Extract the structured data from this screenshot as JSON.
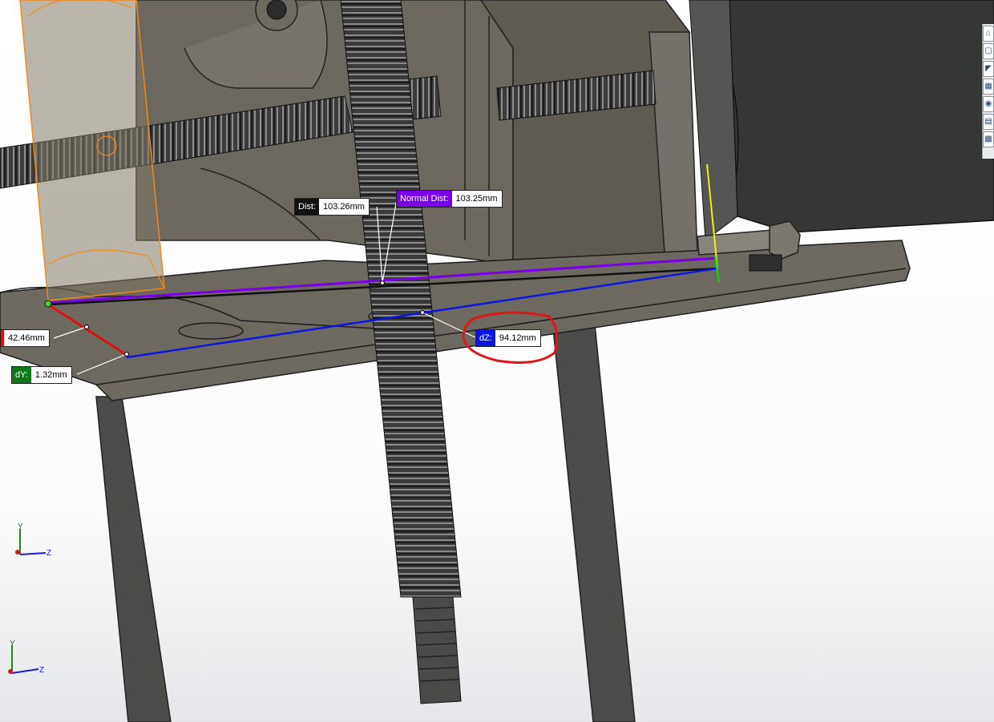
{
  "measurements": {
    "dist": {
      "label": "Dist:",
      "value": "103.26mm"
    },
    "normal_dist": {
      "label": "Normal Dist:",
      "value": "103.25mm"
    },
    "dz": {
      "label": "dZ:",
      "value": "94.12mm"
    },
    "dx": {
      "value": "42.46mm"
    },
    "dy": {
      "label": "dY:",
      "value": "1.32mm"
    }
  },
  "triad": {
    "y_label": "Y",
    "z_label": "Z"
  },
  "toolbar": {
    "buttons": [
      "home-view-icon",
      "view-orientation-icon",
      "section-view-icon",
      "display-style-icon",
      "appearance-icon",
      "scene-icon",
      "screen-capture-icon"
    ]
  },
  "colors": {
    "dist": "#111111",
    "normal_dist": "#7a00e6",
    "dz": "#0b16e0",
    "dy": "#0d7a16",
    "dx": "#e01010",
    "annotation": "#e01515",
    "model_body": "#6a665e"
  }
}
